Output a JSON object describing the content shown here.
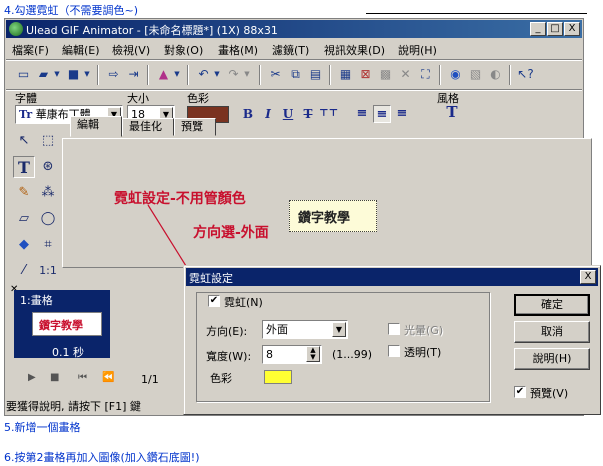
{
  "doc": {
    "step4": "4.勾選霓虹（不需要調色~)",
    "step5": "5.新增一個畫格",
    "step6": "6.按第2畫格再加入圖像(加入鑽石底圖!)"
  },
  "window": {
    "title": "Ulead GIF Animator - [未命名標題*] (1X) 88x31",
    "controls": {
      "minimize": "_",
      "restore": "□",
      "close": "X"
    }
  },
  "menu": [
    "檔案(F)",
    "編輯(E)",
    "檢視(V)",
    "對象(O)",
    "畫格(M)",
    "濾鏡(T)",
    "視訊效果(D)",
    "說明(H)"
  ],
  "fontbar": {
    "font_label": "字體",
    "font_value": "華康布丁體",
    "size_label": "大小",
    "size_value": "18",
    "color_label": "色彩",
    "text_color": "#7a3320",
    "style_label": "風格",
    "format_buttons": [
      "B",
      "I",
      "U",
      "T",
      "T"
    ]
  },
  "tabs": [
    "編輯",
    "最佳化",
    "預覽"
  ],
  "canvas": {
    "annotation1": "霓虹設定-不用管顏色",
    "annotation2": "方向選-外面",
    "preview_text": "鑽字教學"
  },
  "frames": {
    "frame_label": "1:畫格",
    "thumb_text": "鑽字教學",
    "delay": "0.1 秒",
    "count": "1/1"
  },
  "status": "要獲得說明, 請按下 [F1] 鍵",
  "dialog": {
    "title": "霓虹設定",
    "close": "X",
    "neon_checkbox": "霓虹(N)",
    "direction_label": "方向(E):",
    "direction_value": "外面",
    "width_label": "寬度(W):",
    "width_value": "8",
    "width_range": "(1...99)",
    "color_label": "色彩",
    "swatch_color": "#ffff33",
    "halo_label": "光暈(G)",
    "transparent_label": "透明(T)",
    "ok": "確定",
    "cancel": "取消",
    "help": "說明(H)",
    "preview": "預覽(V)"
  }
}
